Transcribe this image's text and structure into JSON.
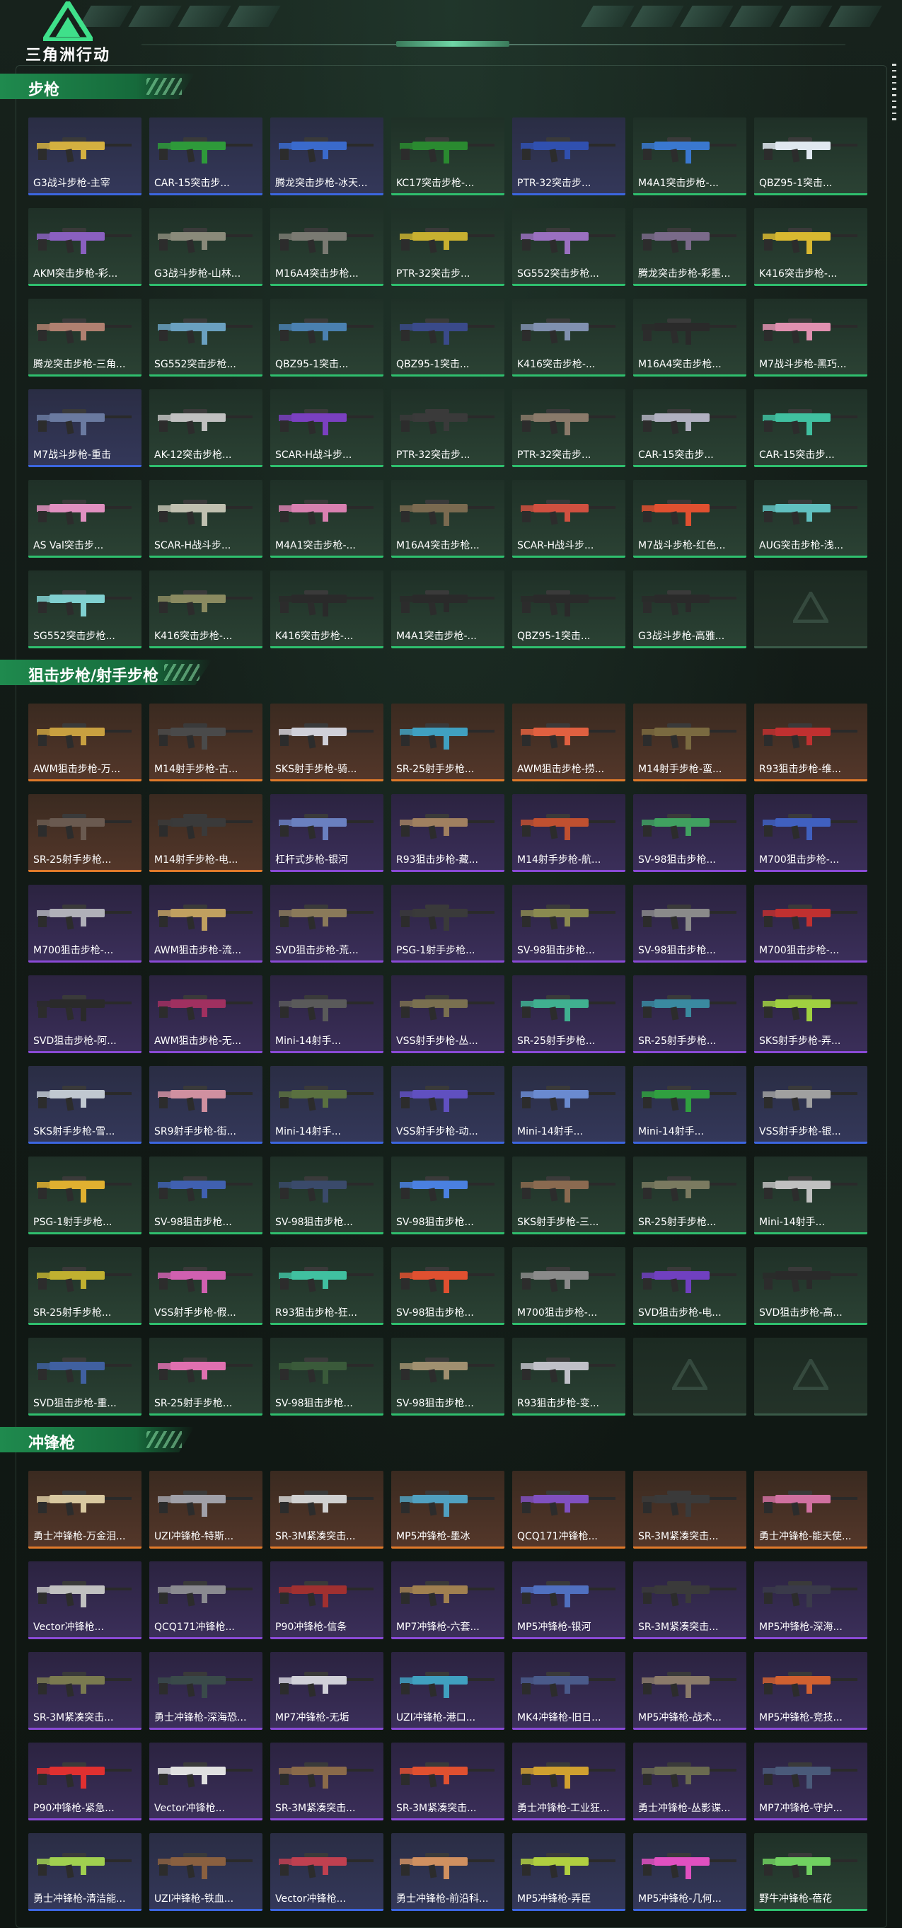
{
  "header": {
    "logo_text": "三角洲行动"
  },
  "sections": [
    {
      "title": "步枪",
      "cards": [
        {
          "label": "G3战斗步枪-主宰",
          "tier": "b",
          "color": "#d4b040"
        },
        {
          "label": "CAR-15突击步...",
          "tier": "b",
          "color": "#2e9a3a"
        },
        {
          "label": "腾龙突击步枪-冰天...",
          "tier": "b",
          "color": "#3a6acc"
        },
        {
          "label": "KC17突击步枪-...",
          "tier": "g",
          "color": "#2a8a30"
        },
        {
          "label": "PTR-32突击步...",
          "tier": "b",
          "color": "#3050b0"
        },
        {
          "label": "M4A1突击步枪-...",
          "tier": "g",
          "color": "#3a78d0"
        },
        {
          "label": "QBZ95-1突击...",
          "tier": "g",
          "color": "#e0e8f0"
        },
        {
          "label": "AKM突击步枪-彩...",
          "tier": "g",
          "color": "#8a60c0"
        },
        {
          "label": "G3战斗步枪-山林...",
          "tier": "g",
          "color": "#8a8a7a"
        },
        {
          "label": "M16A4突击步枪...",
          "tier": "g",
          "color": "#7a7a72"
        },
        {
          "label": "PTR-32突击步...",
          "tier": "g",
          "color": "#c8b030"
        },
        {
          "label": "SG552突击步枪...",
          "tier": "g",
          "color": "#9a70c0"
        },
        {
          "label": "腾龙突击步枪-彩墨...",
          "tier": "g",
          "color": "#7a6a8a"
        },
        {
          "label": "K416突击步枪-...",
          "tier": "g",
          "color": "#d8b830"
        },
        {
          "label": "腾龙突击步枪-三角...",
          "tier": "g",
          "color": "#b08070"
        },
        {
          "label": "SG552突击步枪...",
          "tier": "g",
          "color": "#6aa0c0"
        },
        {
          "label": "QBZ95-1突击...",
          "tier": "g",
          "color": "#4a80b0"
        },
        {
          "label": "QBZ95-1突击...",
          "tier": "g",
          "color": "#3a4a8a"
        },
        {
          "label": "K416突击步枪-...",
          "tier": "g",
          "color": "#8090b0"
        },
        {
          "label": "M16A4突击步枪...",
          "tier": "g",
          "color": "#2a2a2a"
        },
        {
          "label": "M7战斗步枪-黑巧...",
          "tier": "g",
          "color": "#e090b0"
        },
        {
          "label": "M7战斗步枪-重击",
          "tier": "b",
          "color": "#6a7aa0"
        },
        {
          "label": "AK-12突击步枪...",
          "tier": "g",
          "color": "#c0c0c0"
        },
        {
          "label": "SCAR-H战斗步...",
          "tier": "g",
          "color": "#7a40c0"
        },
        {
          "label": "PTR-32突击步...",
          "tier": "g",
          "color": "#3a3a3a"
        },
        {
          "label": "PTR-32突击步...",
          "tier": "g",
          "color": "#8a7a6a"
        },
        {
          "label": "CAR-15突击步...",
          "tier": "g",
          "color": "#b0b0c0"
        },
        {
          "label": "CAR-15突击步...",
          "tier": "g",
          "color": "#40c0a0"
        },
        {
          "label": "AS Val突击步...",
          "tier": "g",
          "color": "#e090c0"
        },
        {
          "label": "SCAR-H战斗步...",
          "tier": "g",
          "color": "#c0c0b0"
        },
        {
          "label": "M4A1突击步枪-...",
          "tier": "g",
          "color": "#d880b0"
        },
        {
          "label": "M16A4突击步枪...",
          "tier": "g",
          "color": "#7a6a50"
        },
        {
          "label": "SCAR-H战斗步...",
          "tier": "g",
          "color": "#d05040"
        },
        {
          "label": "M7战斗步枪-红色...",
          "tier": "g",
          "color": "#e05030"
        },
        {
          "label": "AUG突击步枪-浅...",
          "tier": "g",
          "color": "#60c0c0"
        },
        {
          "label": "SG552突击步枪...",
          "tier": "g",
          "color": "#80d0d0"
        },
        {
          "label": "K416突击步枪-...",
          "tier": "g",
          "color": "#8a8a60"
        },
        {
          "label": "K416突击步枪-...",
          "tier": "g",
          "color": "#2a2a2a"
        },
        {
          "label": "M4A1突击步枪-...",
          "tier": "g",
          "color": "#2a2a2a"
        },
        {
          "label": "QBZ95-1突击...",
          "tier": "g",
          "color": "#2a2a2a"
        },
        {
          "label": "G3战斗步枪-高雅...",
          "tier": "g",
          "color": "#2a2a2a"
        },
        {
          "label": "",
          "tier": "empty",
          "color": ""
        }
      ]
    },
    {
      "title": "狙击步枪/射手步枪",
      "cards": [
        {
          "label": "AWM狙击步枪-万...",
          "tier": "o",
          "color": "#c8a040"
        },
        {
          "label": "M14射手步枪-古...",
          "tier": "o",
          "color": "#4a4a4a"
        },
        {
          "label": "SKS射手步枪-骑...",
          "tier": "o",
          "color": "#d0d0d8"
        },
        {
          "label": "SR-25射手步枪...",
          "tier": "o",
          "color": "#40a0c0"
        },
        {
          "label": "AWM狙击步枪-捞...",
          "tier": "o",
          "color": "#e06040"
        },
        {
          "label": "M14射手步枪-蛮...",
          "tier": "o",
          "color": "#7a6a40"
        },
        {
          "label": "R93狙击步枪-维...",
          "tier": "o",
          "color": "#c03030"
        },
        {
          "label": "SR-25射手步枪...",
          "tier": "o",
          "color": "#6a5a50"
        },
        {
          "label": "M14射手步枪-电...",
          "tier": "o",
          "color": "#3a3a3a"
        },
        {
          "label": "杠杆式步枪-银河",
          "tier": "p",
          "color": "#6a80c0"
        },
        {
          "label": "R93狙击步枪-藏...",
          "tier": "p",
          "color": "#a08060"
        },
        {
          "label": "M14射手步枪-航...",
          "tier": "p",
          "color": "#c05030"
        },
        {
          "label": "SV-98狙击步枪...",
          "tier": "p",
          "color": "#40a060"
        },
        {
          "label": "M700狙击步枪-...",
          "tier": "p",
          "color": "#4060c0"
        },
        {
          "label": "M700狙击步枪-...",
          "tier": "p",
          "color": "#b0b0b8"
        },
        {
          "label": "AWM狙击步枪-流...",
          "tier": "p",
          "color": "#c0a060"
        },
        {
          "label": "SVD狙击步枪-荒...",
          "tier": "p",
          "color": "#8a7a5a"
        },
        {
          "label": "PSG-1射手步枪...",
          "tier": "p",
          "color": "#3a3a3a"
        },
        {
          "label": "SV-98狙击步枪...",
          "tier": "p",
          "color": "#8a8a50"
        },
        {
          "label": "SV-98狙击步枪...",
          "tier": "p",
          "color": "#8a8a8a"
        },
        {
          "label": "M700狙击步枪-...",
          "tier": "p",
          "color": "#c03030"
        },
        {
          "label": "SVD狙击步枪-阿...",
          "tier": "p",
          "color": "#2a2a2a"
        },
        {
          "label": "AWM狙击步枪-无...",
          "tier": "p",
          "color": "#a03060"
        },
        {
          "label": "Mini-14射手...",
          "tier": "p",
          "color": "#5a5a5a"
        },
        {
          "label": "VSS射手步枪-丛...",
          "tier": "p",
          "color": "#7a7050"
        },
        {
          "label": "SR-25射手步枪...",
          "tier": "p",
          "color": "#40b090"
        },
        {
          "label": "SR-25射手步枪...",
          "tier": "p",
          "color": "#3a8aa0"
        },
        {
          "label": "SKS射手步枪-弄...",
          "tier": "p",
          "color": "#a0d040"
        },
        {
          "label": "SKS射手步枪-雪...",
          "tier": "b",
          "color": "#c0c8d0"
        },
        {
          "label": "SR9射手步枪-街...",
          "tier": "b",
          "color": "#d090a0"
        },
        {
          "label": "Mini-14射手...",
          "tier": "b",
          "color": "#5a7040"
        },
        {
          "label": "VSS射手步枪-动...",
          "tier": "b",
          "color": "#6050c0"
        },
        {
          "label": "Mini-14射手...",
          "tier": "b",
          "color": "#6a8ad0"
        },
        {
          "label": "Mini-14射手...",
          "tier": "b",
          "color": "#30a040"
        },
        {
          "label": "VSS射手步枪-银...",
          "tier": "b",
          "color": "#a0a0a0"
        },
        {
          "label": "PSG-1射手步枪...",
          "tier": "g",
          "color": "#e0b030"
        },
        {
          "label": "SV-98狙击步枪...",
          "tier": "g",
          "color": "#4060b0"
        },
        {
          "label": "SV-98狙击步枪...",
          "tier": "g",
          "color": "#3a4a6a"
        },
        {
          "label": "SV-98狙击步枪...",
          "tier": "g",
          "color": "#4a80e0"
        },
        {
          "label": "SKS射手步枪-三...",
          "tier": "g",
          "color": "#8a6a50"
        },
        {
          "label": "SR-25射手步枪...",
          "tier": "g",
          "color": "#7a7a60"
        },
        {
          "label": "Mini-14射手...",
          "tier": "g",
          "color": "#c0c0c0"
        },
        {
          "label": "SR-25射手步枪...",
          "tier": "g",
          "color": "#c0b030"
        },
        {
          "label": "VSS射手步枪-假...",
          "tier": "g",
          "color": "#d060b0"
        },
        {
          "label": "R93狙击步枪-狂...",
          "tier": "g",
          "color": "#40c0a0"
        },
        {
          "label": "SV-98狙击步枪...",
          "tier": "g",
          "color": "#e05030"
        },
        {
          "label": "M700狙击步枪-...",
          "tier": "g",
          "color": "#8a8a8a"
        },
        {
          "label": "SVD狙击步枪-电...",
          "tier": "g",
          "color": "#7040c0"
        },
        {
          "label": "SVD狙击步枪-高...",
          "tier": "g",
          "color": "#2a2a2a"
        },
        {
          "label": "SVD狙击步枪-重...",
          "tier": "g",
          "color": "#4060a0"
        },
        {
          "label": "SR-25射手步枪...",
          "tier": "g",
          "color": "#e070b0"
        },
        {
          "label": "SV-98狙击步枪...",
          "tier": "g",
          "color": "#3a5a3a"
        },
        {
          "label": "SV-98狙击步枪...",
          "tier": "g",
          "color": "#a09070"
        },
        {
          "label": "R93狙击步枪-变...",
          "tier": "g",
          "color": "#c0c0c8"
        },
        {
          "label": "",
          "tier": "empty",
          "color": ""
        },
        {
          "label": "",
          "tier": "empty",
          "color": ""
        }
      ]
    },
    {
      "title": "冲锋枪",
      "cards": [
        {
          "label": "勇士冲锋枪-万金泪...",
          "tier": "o",
          "color": "#d8c8a0"
        },
        {
          "label": "UZI冲锋枪-特斯...",
          "tier": "o",
          "color": "#a0a0a8"
        },
        {
          "label": "SR-3M紧凑突击...",
          "tier": "o",
          "color": "#d0d0d0"
        },
        {
          "label": "MP5冲锋枪-墨冰",
          "tier": "o",
          "color": "#50a0c0"
        },
        {
          "label": "QCQ171冲锋枪...",
          "tier": "o",
          "color": "#8050c0"
        },
        {
          "label": "SR-3M紧凑突击...",
          "tier": "o",
          "color": "#3a3a3a"
        },
        {
          "label": "勇士冲锋枪-能天使...",
          "tier": "o",
          "color": "#d070a0"
        },
        {
          "label": "Vector冲锋枪...",
          "tier": "p",
          "color": "#c0c0c0"
        },
        {
          "label": "QCQ171冲锋枪...",
          "tier": "p",
          "color": "#8a8a90"
        },
        {
          "label": "P90冲锋枪-信条",
          "tier": "p",
          "color": "#a03030"
        },
        {
          "label": "MP7冲锋枪-六套...",
          "tier": "p",
          "color": "#a08050"
        },
        {
          "label": "MP5冲锋枪-银河",
          "tier": "p",
          "color": "#5070c0"
        },
        {
          "label": "SR-3M紧凑突击...",
          "tier": "p",
          "color": "#3a3a3a"
        },
        {
          "label": "MP5冲锋枪-深海...",
          "tier": "p",
          "color": "#3a3a4a"
        },
        {
          "label": "SR-3M紧凑突击...",
          "tier": "p",
          "color": "#7a7a50"
        },
        {
          "label": "勇士冲锋枪-深海恐...",
          "tier": "p",
          "color": "#3a4a4a"
        },
        {
          "label": "MP7冲锋枪-无垢",
          "tier": "p",
          "color": "#d0d0d8"
        },
        {
          "label": "UZI冲锋枪-港口...",
          "tier": "p",
          "color": "#40a0c0"
        },
        {
          "label": "MK4冲锋枪-旧日...",
          "tier": "p",
          "color": "#4a5a8a"
        },
        {
          "label": "MP5冲锋枪-战术...",
          "tier": "p",
          "color": "#8a7a6a"
        },
        {
          "label": "MP5冲锋枪-竞技...",
          "tier": "p",
          "color": "#d06030"
        },
        {
          "label": "P90冲锋枪-紧急...",
          "tier": "p",
          "color": "#e03030"
        },
        {
          "label": "Vector冲锋枪...",
          "tier": "p",
          "color": "#e0e0e0"
        },
        {
          "label": "SR-3M紧凑突击...",
          "tier": "p",
          "color": "#8a6a4a"
        },
        {
          "label": "SR-3M紧凑突击...",
          "tier": "p",
          "color": "#e05030"
        },
        {
          "label": "勇士冲锋枪-工业狂...",
          "tier": "p",
          "color": "#d0a030"
        },
        {
          "label": "勇士冲锋枪-丛影谍...",
          "tier": "p",
          "color": "#6a6a50"
        },
        {
          "label": "MP7冲锋枪-守护...",
          "tier": "p",
          "color": "#4a5a7a"
        },
        {
          "label": "勇士冲锋枪-清洁能...",
          "tier": "b",
          "color": "#a0d050"
        },
        {
          "label": "UZI冲锋枪-铁血...",
          "tier": "b",
          "color": "#8a6040"
        },
        {
          "label": "Vector冲锋枪...",
          "tier": "b",
          "color": "#c04050"
        },
        {
          "label": "勇士冲锋枪-前沿科...",
          "tier": "b",
          "color": "#d09060"
        },
        {
          "label": "MP5冲锋枪-弄臣",
          "tier": "b",
          "color": "#b0d040"
        },
        {
          "label": "MP5冲锋枪-几何...",
          "tier": "b",
          "color": "#e050c0"
        },
        {
          "label": "野牛冲锋枪-蓓花",
          "tier": "g",
          "color": "#70d060"
        }
      ]
    }
  ]
}
